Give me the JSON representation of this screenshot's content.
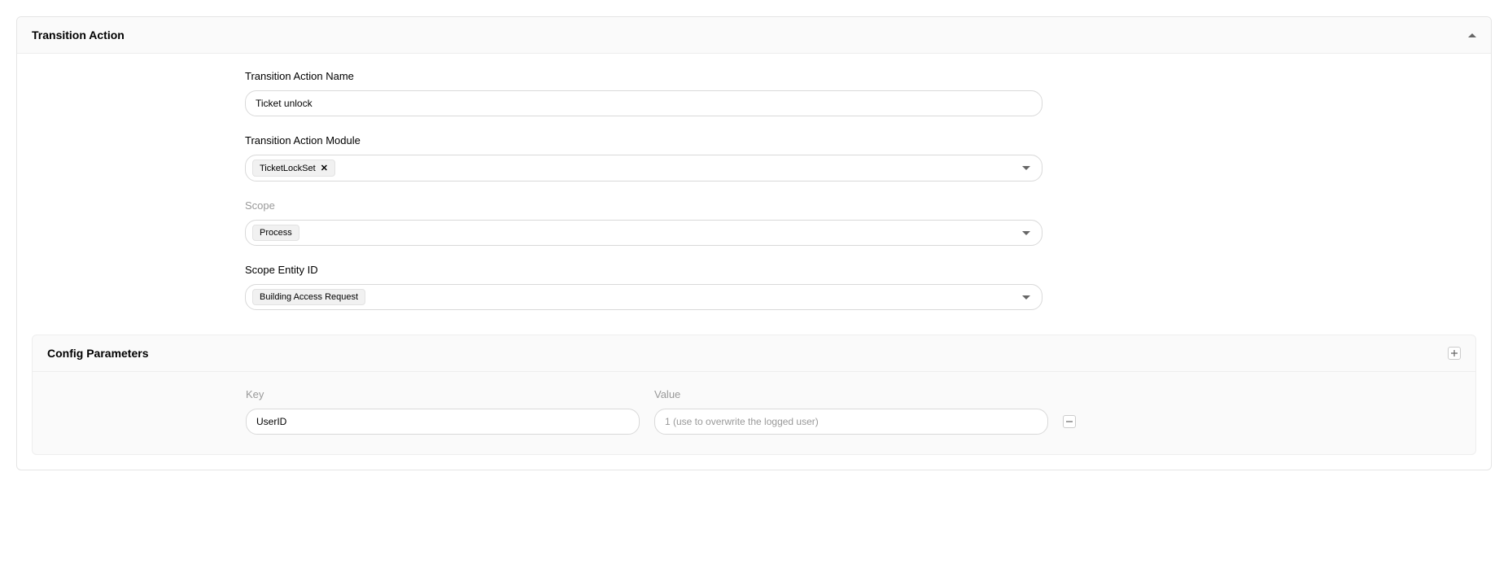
{
  "panel": {
    "title": "Transition Action"
  },
  "fields": {
    "name_label": "Transition Action Name",
    "name_value": "Ticket unlock",
    "module_label": "Transition Action Module",
    "module_value": "TicketLockSet",
    "scope_label": "Scope",
    "scope_value": "Process",
    "scope_entity_label": "Scope Entity ID",
    "scope_entity_value": "Building Access Request"
  },
  "config": {
    "title": "Config Parameters",
    "key_label": "Key",
    "value_label": "Value",
    "rows": [
      {
        "key": "UserID",
        "value": "",
        "placeholder": "1 (use to overwrite the logged user)"
      }
    ]
  }
}
